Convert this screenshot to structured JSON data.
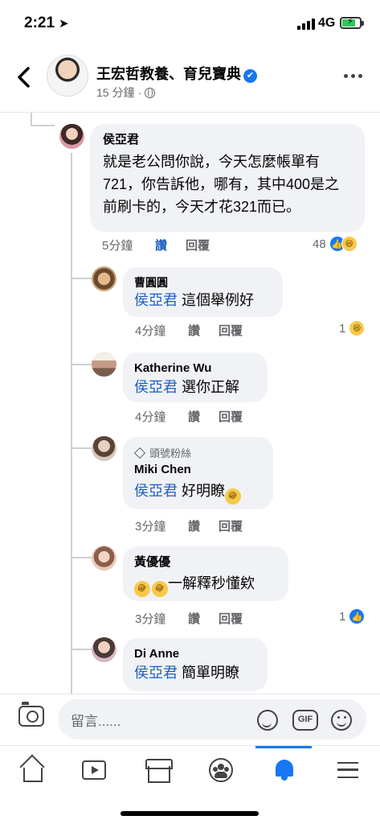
{
  "status_bar": {
    "time": "2:21",
    "network": "4G"
  },
  "header": {
    "page_name": "王宏哲教養、育兒寶典",
    "time_ago": "15 分鐘",
    "separator": "·"
  },
  "actions": {
    "like_label": "讚",
    "reply_label": "回覆"
  },
  "main_comment": {
    "author": "侯亞君",
    "text": "就是老公問你說，今天怎麼帳單有721，你告訴他，哪有，其中400是之前刷卡的，今天才花321而已。",
    "time": "5分鐘",
    "reaction_count": "48"
  },
  "replies": [
    {
      "author": "曹圓圓",
      "mention": "侯亞君",
      "text": " 這個舉例好",
      "time": "4分鐘",
      "reaction_count": "1"
    },
    {
      "author": "Katherine Wu",
      "mention": "侯亞君",
      "text": " 選你正解",
      "time": "4分鐘"
    },
    {
      "author": "Miki Chen",
      "badge": "頭號粉絲",
      "mention": "侯亞君",
      "text": " 好明瞭",
      "time": "3分鐘"
    },
    {
      "author": "黃優優",
      "text": "一解釋秒懂欸",
      "time": "3分鐘",
      "reaction_count": "1"
    },
    {
      "author": "Di Anne",
      "mention": "侯亞君",
      "text": " 簡單明瞭"
    }
  ],
  "composer": {
    "placeholder": "留言......",
    "gif_label": "GIF"
  },
  "icons": [
    "back-arrow-icon",
    "verified-icon",
    "globe-icon",
    "more-icon",
    "like-reaction-icon",
    "haha-reaction-icon",
    "rofl-emoji-icon",
    "camera-icon",
    "sticker-icon",
    "gif-icon",
    "emoji-icon",
    "home-icon",
    "watch-icon",
    "marketplace-icon",
    "groups-icon",
    "bell-icon",
    "menu-icon"
  ],
  "colors": {
    "accent": "#1877f2",
    "mention": "#1d5fbf",
    "bubble": "#f0f2f5",
    "secondary_text": "#65676b"
  }
}
